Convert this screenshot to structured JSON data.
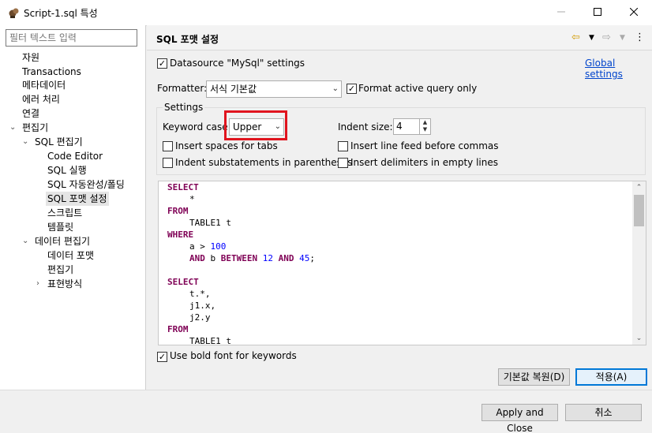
{
  "window": {
    "title": "Script-1.sql 특성",
    "min_icon": "minimize-icon",
    "max_icon": "maximize-icon",
    "close_icon": "close-icon"
  },
  "sidebar": {
    "filter_placeholder": "필터 텍스트 입력",
    "items": [
      {
        "label": "자원"
      },
      {
        "label": "Transactions"
      },
      {
        "label": "메타데이터"
      },
      {
        "label": "에러 처리"
      },
      {
        "label": "연결"
      },
      {
        "label": "편집기"
      },
      {
        "label": "SQL 편집기"
      },
      {
        "label": "Code Editor"
      },
      {
        "label": "SQL 실행"
      },
      {
        "label": "SQL 자동완성/폴딩"
      },
      {
        "label": "SQL 포맷 설정"
      },
      {
        "label": "스크립트"
      },
      {
        "label": "템플릿"
      },
      {
        "label": "데이터 편집기"
      },
      {
        "label": "데이터 포맷"
      },
      {
        "label": "편집기"
      },
      {
        "label": "표현방식"
      }
    ]
  },
  "page": {
    "title": "SQL 포맷 설정",
    "datasource_label": "Datasource \"MySql\" settings",
    "datasource_checked": true,
    "global_settings_link": "Global settings",
    "formatter_label": "Formatter:",
    "formatter_value": "서식 기본값",
    "format_active_label": "Format active query only",
    "format_active_checked": true,
    "settings_group_label": "Settings",
    "keyword_case_label": "Keyword case:",
    "keyword_case_value": "Upper",
    "indent_size_label": "Indent size:",
    "indent_size_value": "4",
    "options": {
      "spaces_for_tabs": "Insert spaces for tabs",
      "line_feed_commas": "Insert line feed before commas",
      "indent_substatements": "Indent substatements in parentheses",
      "delimiters_empty_lines": "Insert delimiters in empty lines"
    },
    "bold_keywords_label": "Use bold font for keywords",
    "bold_keywords_checked": true,
    "restore_defaults": "기본값 복원(D)",
    "apply": "적용(A)"
  },
  "preview": {
    "lines": [
      {
        "indent": 0,
        "tokens": [
          {
            "t": "SELECT",
            "c": "kw"
          }
        ]
      },
      {
        "indent": 1,
        "tokens": [
          {
            "t": "*",
            "c": ""
          }
        ]
      },
      {
        "indent": 0,
        "tokens": [
          {
            "t": "FROM",
            "c": "kw"
          }
        ]
      },
      {
        "indent": 1,
        "tokens": [
          {
            "t": "TABLE1 t",
            "c": ""
          }
        ]
      },
      {
        "indent": 0,
        "tokens": [
          {
            "t": "WHERE",
            "c": "kw"
          }
        ]
      },
      {
        "indent": 1,
        "tokens": [
          {
            "t": "a > ",
            "c": ""
          },
          {
            "t": "100",
            "c": "num"
          }
        ]
      },
      {
        "indent": 1,
        "tokens": [
          {
            "t": "AND",
            "c": "kw"
          },
          {
            "t": " b ",
            "c": ""
          },
          {
            "t": "BETWEEN",
            "c": "kw"
          },
          {
            "t": " ",
            "c": ""
          },
          {
            "t": "12",
            "c": "num"
          },
          {
            "t": " ",
            "c": ""
          },
          {
            "t": "AND",
            "c": "kw"
          },
          {
            "t": " ",
            "c": ""
          },
          {
            "t": "45",
            "c": "num"
          },
          {
            "t": ";",
            "c": ""
          }
        ]
      },
      {
        "indent": 0,
        "tokens": []
      },
      {
        "indent": 0,
        "tokens": [
          {
            "t": "SELECT",
            "c": "kw"
          }
        ]
      },
      {
        "indent": 1,
        "tokens": [
          {
            "t": "t.*,",
            "c": ""
          }
        ]
      },
      {
        "indent": 1,
        "tokens": [
          {
            "t": "j1.x,",
            "c": ""
          }
        ]
      },
      {
        "indent": 1,
        "tokens": [
          {
            "t": "j2.y",
            "c": ""
          }
        ]
      },
      {
        "indent": 0,
        "tokens": [
          {
            "t": "FROM",
            "c": "kw"
          }
        ]
      },
      {
        "indent": 1,
        "tokens": [
          {
            "t": "TABLE1 t",
            "c": ""
          }
        ]
      }
    ]
  },
  "footer": {
    "apply_close": "Apply and Close",
    "cancel": "취소"
  }
}
